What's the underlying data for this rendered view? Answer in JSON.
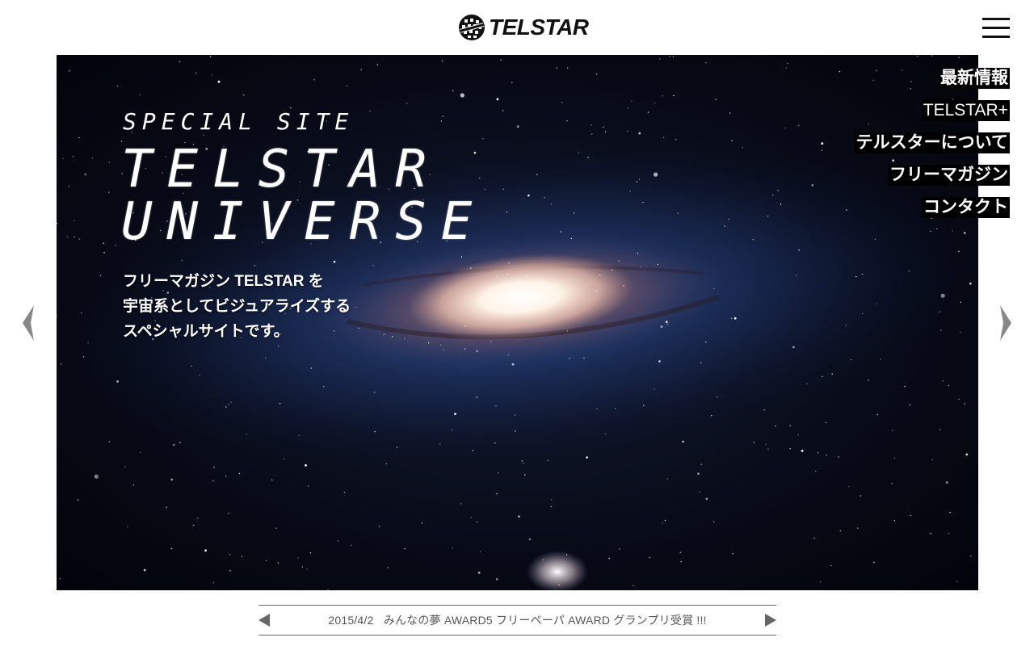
{
  "header": {
    "logo_text": "TELSTAR",
    "menu_icon": "hamburger-menu-icon"
  },
  "hero": {
    "eyebrow": "SPECIAL SITE",
    "title_line1": "TELSTAR",
    "title_line2": "UNIVERSE",
    "description": [
      "フリーマガジン TELSTAR を",
      "宇宙系としてビジュアライズする",
      "スペシャルサイトです。"
    ],
    "background": "galaxy-image"
  },
  "nav": {
    "items": [
      {
        "label": "最新情報"
      },
      {
        "label": "TELSTAR+"
      },
      {
        "label": "テルスターについて"
      },
      {
        "label": "フリーマガジン"
      },
      {
        "label": "コンタクト"
      }
    ]
  },
  "slider": {
    "prev_icon": "chevron-left-icon",
    "next_icon": "chevron-right-icon"
  },
  "ticker": {
    "date": "2015/4/2",
    "text": "みんなの夢 AWARD5 フリーペーパ AWARD グランプリ受賞 !!!",
    "prev_icon": "triangle-left-icon",
    "next_icon": "triangle-right-icon"
  },
  "colors": {
    "nav_bg": "#000000",
    "nav_text": "#ffffff",
    "ticker_text": "#555555",
    "border": "#666666"
  }
}
